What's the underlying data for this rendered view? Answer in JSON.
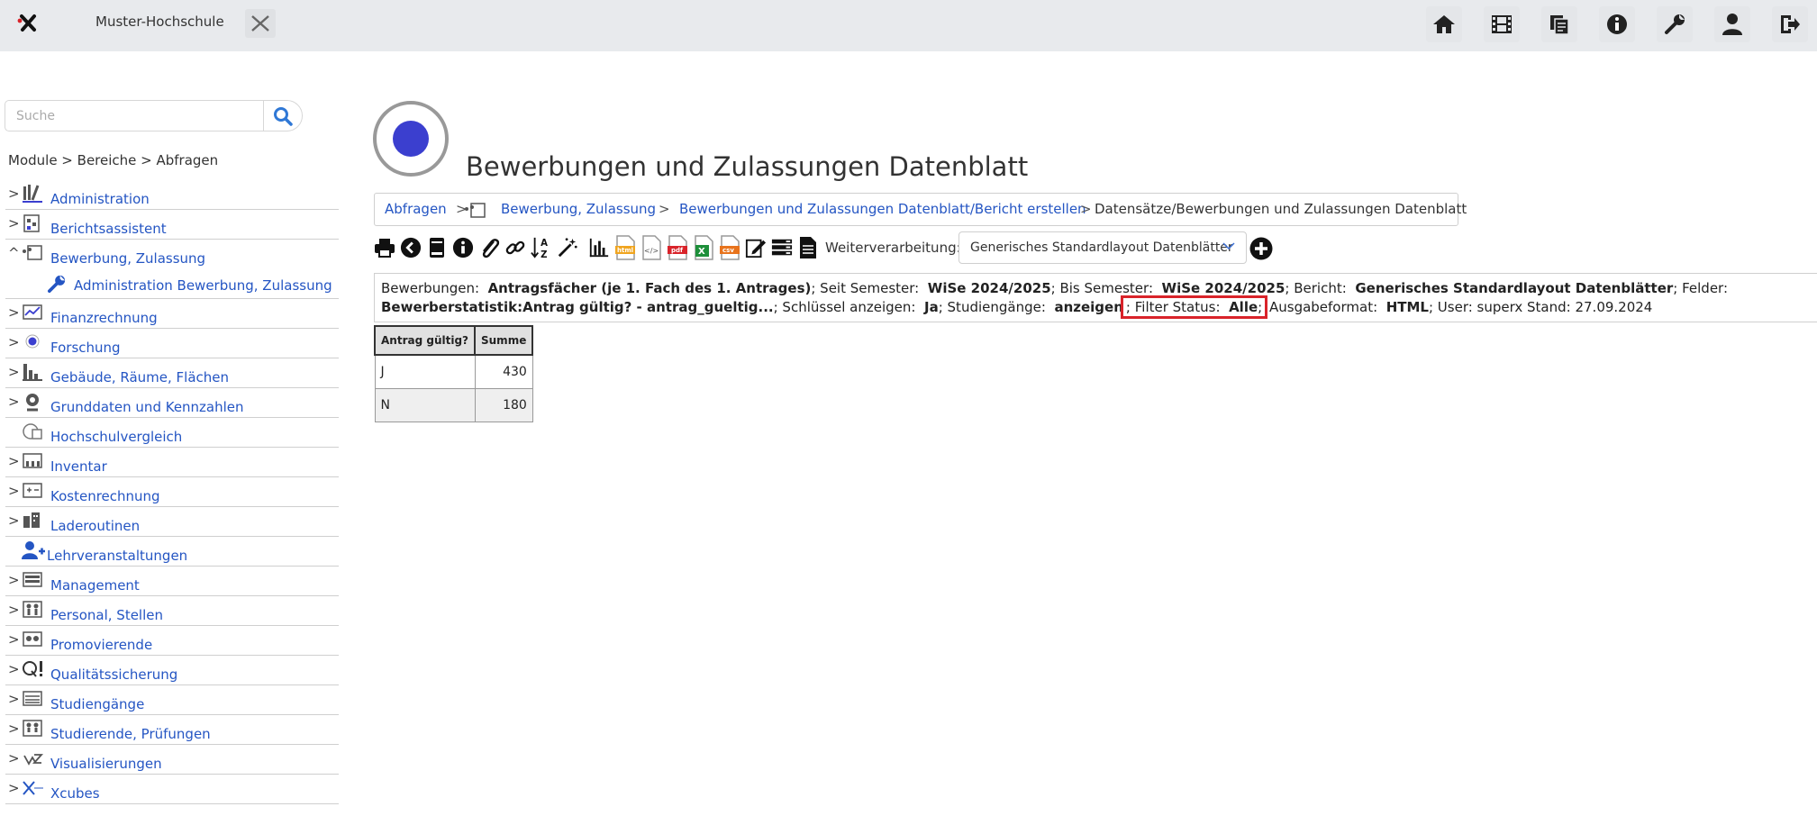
{
  "app": {
    "title": "Muster-Hochschule"
  },
  "colors": {
    "topbar": "#e8eaed",
    "link": "#2455c3",
    "highlight": "#d9232a",
    "accent": "#3b3fcf"
  },
  "top_icons": [
    "home-icon",
    "film-icon",
    "copy-icon",
    "info-icon",
    "wrench-icon",
    "user-icon",
    "logout-icon"
  ],
  "search": {
    "placeholder": "Suche",
    "value": ""
  },
  "sidebar": {
    "breadcrumb": "Module > Bereiche > Abfragen",
    "items": [
      {
        "label": "Administration",
        "arrow": ">"
      },
      {
        "label": "Berichtsassistent",
        "arrow": ">"
      },
      {
        "label": "Bewerbung, Zulassung",
        "arrow": "^"
      },
      {
        "label": "Administration Bewerbung, Zulassung",
        "arrow": ""
      },
      {
        "label": "Finanzrechnung",
        "arrow": ">"
      },
      {
        "label": "Forschung",
        "arrow": ">"
      },
      {
        "label": "Gebäude, Räume, Flächen",
        "arrow": ">"
      },
      {
        "label": "Grunddaten und Kennzahlen",
        "arrow": ">"
      },
      {
        "label": "Hochschulvergleich",
        "arrow": ""
      },
      {
        "label": "Inventar",
        "arrow": ">"
      },
      {
        "label": "Kostenrechnung",
        "arrow": ">"
      },
      {
        "label": "Laderoutinen",
        "arrow": ">"
      },
      {
        "label": "Lehrveranstaltungen",
        "arrow": ""
      },
      {
        "label": "Management",
        "arrow": ">"
      },
      {
        "label": "Personal, Stellen",
        "arrow": ">"
      },
      {
        "label": "Promovierende",
        "arrow": ">"
      },
      {
        "label": "Qualitätssicherung",
        "arrow": ">"
      },
      {
        "label": "Studiengänge",
        "arrow": ">"
      },
      {
        "label": "Studierende, Prüfungen",
        "arrow": ">"
      },
      {
        "label": "Visualisierungen",
        "arrow": ">"
      },
      {
        "label": "Xcubes",
        "arrow": ">"
      }
    ]
  },
  "main": {
    "title": "Bewerbungen und Zulassungen Datenblatt",
    "breadcrumb": {
      "b0": "Abfragen",
      "b1": "Bewerbung, Zulassung",
      "b2": "Bewerbungen und Zulassungen Datenblatt/Bericht erstellen",
      "b3": "Datensätze/Bewerbungen und Zulassungen Datenblatt",
      "sep": ">"
    },
    "weiterverarbeitung": {
      "label": "Weiterverarbeitung:",
      "selected": "Generisches Standardlayout Datenblätter"
    },
    "info": {
      "k1": "Bewerbungen:",
      "v1": "Antragsfächer (je 1. Fach des 1. Antrages)",
      "k2": "; Seit Semester:",
      "v2": "WiSe 2024/2025",
      "k3": "; Bis Semester:",
      "v3": "WiSe 2024/2025",
      "k4": "; Bericht:",
      "v4": "Generisches Standardlayout Datenblätter",
      "k5": "; Felder:",
      "v5": "Bewerberstatistik:Antrag gültig? - antrag_gueltig...",
      "k6": "; Schlüssel anzeigen:",
      "v6": "Ja",
      "k7": "; Studiengänge:",
      "v7": "anzeigen",
      "k8": "Filter Status:",
      "v8": "Alle",
      "k9": "Ausgabeformat:",
      "v9": "HTML",
      "k10": "; User: superx Stand: 27.09.2024",
      "semi": ";"
    },
    "table": {
      "headers": [
        "Antrag gültig?",
        "Summe"
      ],
      "rows": [
        [
          "J",
          "430"
        ],
        [
          "N",
          "180"
        ]
      ]
    }
  }
}
